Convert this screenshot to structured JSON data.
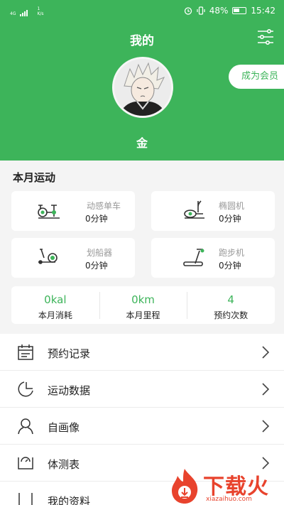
{
  "status_bar": {
    "network": "4G",
    "speed": "1",
    "speed_unit": "K/s",
    "battery": "48%",
    "time": "15:42"
  },
  "header": {
    "title": "我的",
    "member_button": "成为会员",
    "nickname": "金",
    "bg_color": "#3db45a"
  },
  "monthly": {
    "title": "本月运动",
    "equipment": [
      {
        "icon": "spin-bike-icon",
        "name": "动感单车",
        "value": "0分钟"
      },
      {
        "icon": "elliptical-icon",
        "name": "椭圆机",
        "value": "0分钟"
      },
      {
        "icon": "rowing-machine-icon",
        "name": "划船器",
        "value": "0分钟"
      },
      {
        "icon": "treadmill-icon",
        "name": "跑步机",
        "value": "0分钟"
      }
    ],
    "stats": [
      {
        "value": "0kal",
        "label": "本月消耗"
      },
      {
        "value": "0km",
        "label": "本月里程"
      },
      {
        "value": "4",
        "label": "预约次数"
      }
    ]
  },
  "menu": [
    {
      "icon": "calendar-icon",
      "label": "预约记录"
    },
    {
      "icon": "chart-icon",
      "label": "运动数据"
    },
    {
      "icon": "person-icon",
      "label": "自画像"
    },
    {
      "icon": "scale-icon",
      "label": "体测表"
    },
    {
      "icon": "profile-icon",
      "label": "我的资料"
    }
  ],
  "watermark": {
    "text": "下载火",
    "url": "xiazaihuo.com"
  }
}
